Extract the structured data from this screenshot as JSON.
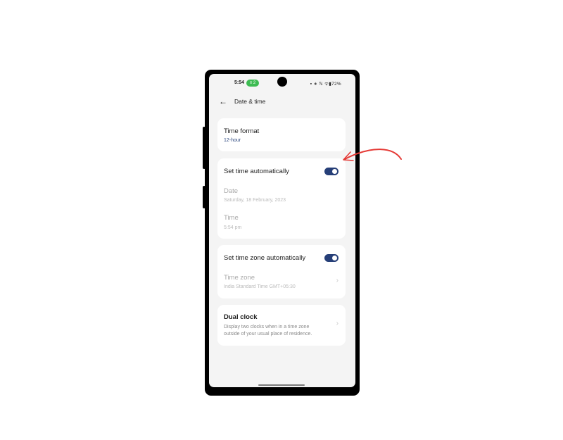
{
  "status_bar": {
    "time": "5:54",
    "notification_badge": "2",
    "icons": "▪ ∗ ℕ ᯤ▮72%",
    "battery": "72%"
  },
  "header": {
    "back_icon": "←",
    "title": "Date & time"
  },
  "time_format": {
    "title": "Time format",
    "value": "12-hour"
  },
  "auto_time": {
    "title": "Set time automatically",
    "enabled": true,
    "date_label": "Date",
    "date_value": "Saturday, 18 February, 2023",
    "time_label": "Time",
    "time_value": "5:54 pm"
  },
  "auto_timezone": {
    "title": "Set time zone automatically",
    "enabled": true,
    "timezone_label": "Time zone",
    "timezone_value": "India Standard Time GMT+05:30",
    "chevron": "›"
  },
  "dual_clock": {
    "title": "Dual clock",
    "description_line1": "Display two clocks when in a time zone",
    "description_line2": "outside of your usual place of residence.",
    "chevron": "›"
  },
  "annotation": {
    "arrow_color": "#e53935"
  }
}
